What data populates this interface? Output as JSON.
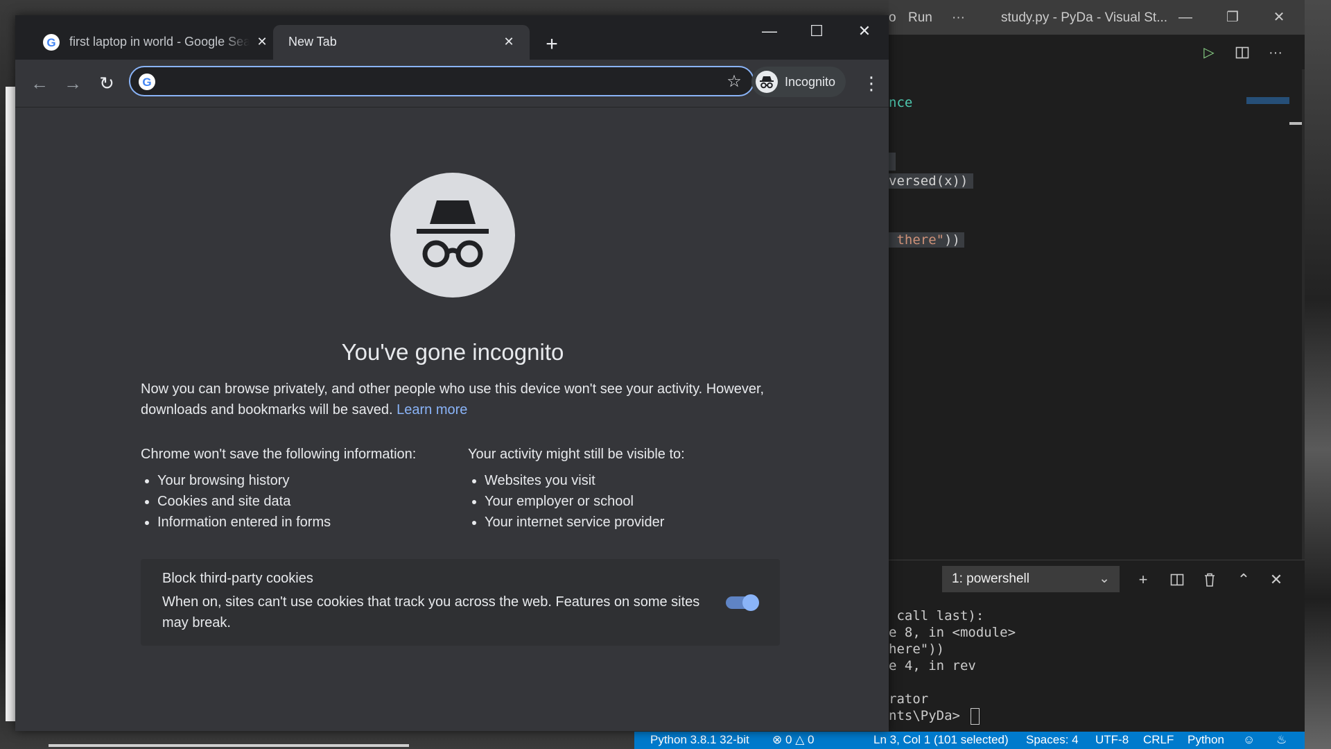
{
  "chrome": {
    "tabs": [
      {
        "label": "first laptop in world - Google Search",
        "active": false
      },
      {
        "label": "New Tab",
        "active": true
      }
    ],
    "omnibox": {
      "value": "",
      "placeholder": ""
    },
    "profile_label": "Incognito",
    "page": {
      "headline": "You've gone incognito",
      "intro": "Now you can browse privately, and other people who use this device won't see your activity. However, downloads and bookmarks will be saved.",
      "learn_more": "Learn more",
      "not_saved_heading": "Chrome won't save the following information:",
      "not_saved_items": [
        "Your browsing history",
        "Cookies and site data",
        "Information entered in forms"
      ],
      "visible_heading": "Your activity might still be visible to:",
      "visible_items": [
        "Websites you visit",
        "Your employer or school",
        "Your internet service provider"
      ],
      "cookie_card": {
        "title": "Block third-party cookies",
        "description": "When on, sites can't use cookies that track you across the web. Features on some sites may break.",
        "toggle_on": true
      }
    },
    "colors": {
      "accent": "#8ab4f8",
      "background": "#35363a",
      "tabstrip": "#202124"
    }
  },
  "vscode": {
    "title_menu_partial": "o",
    "menu_run": "Run",
    "menu_more": "···",
    "window_title": "study.py - PyDa - Visual St...",
    "editor_lines": [
      {
        "text": "nce"
      },
      {
        "text": "versed(x))"
      },
      {
        "prefix": "",
        "string": " there\"",
        "suffix": "))"
      }
    ],
    "terminal_selector": "1: powershell",
    "terminal_lines": [
      " call last):",
      "e 8, in <module>",
      "here\"))",
      "e 4, in rev",
      "",
      "rator",
      "nts\\PyDa> "
    ],
    "status": {
      "python": "Python 3.8.1 32-bit",
      "errors": "0",
      "warnings": "0",
      "position": "Ln 3, Col 1 (101 selected)",
      "spaces": "Spaces: 4",
      "encoding": "UTF-8",
      "eol": "CRLF",
      "language": "Python"
    },
    "colors": {
      "statusbar": "#007acc",
      "string": "#ce9178"
    }
  }
}
